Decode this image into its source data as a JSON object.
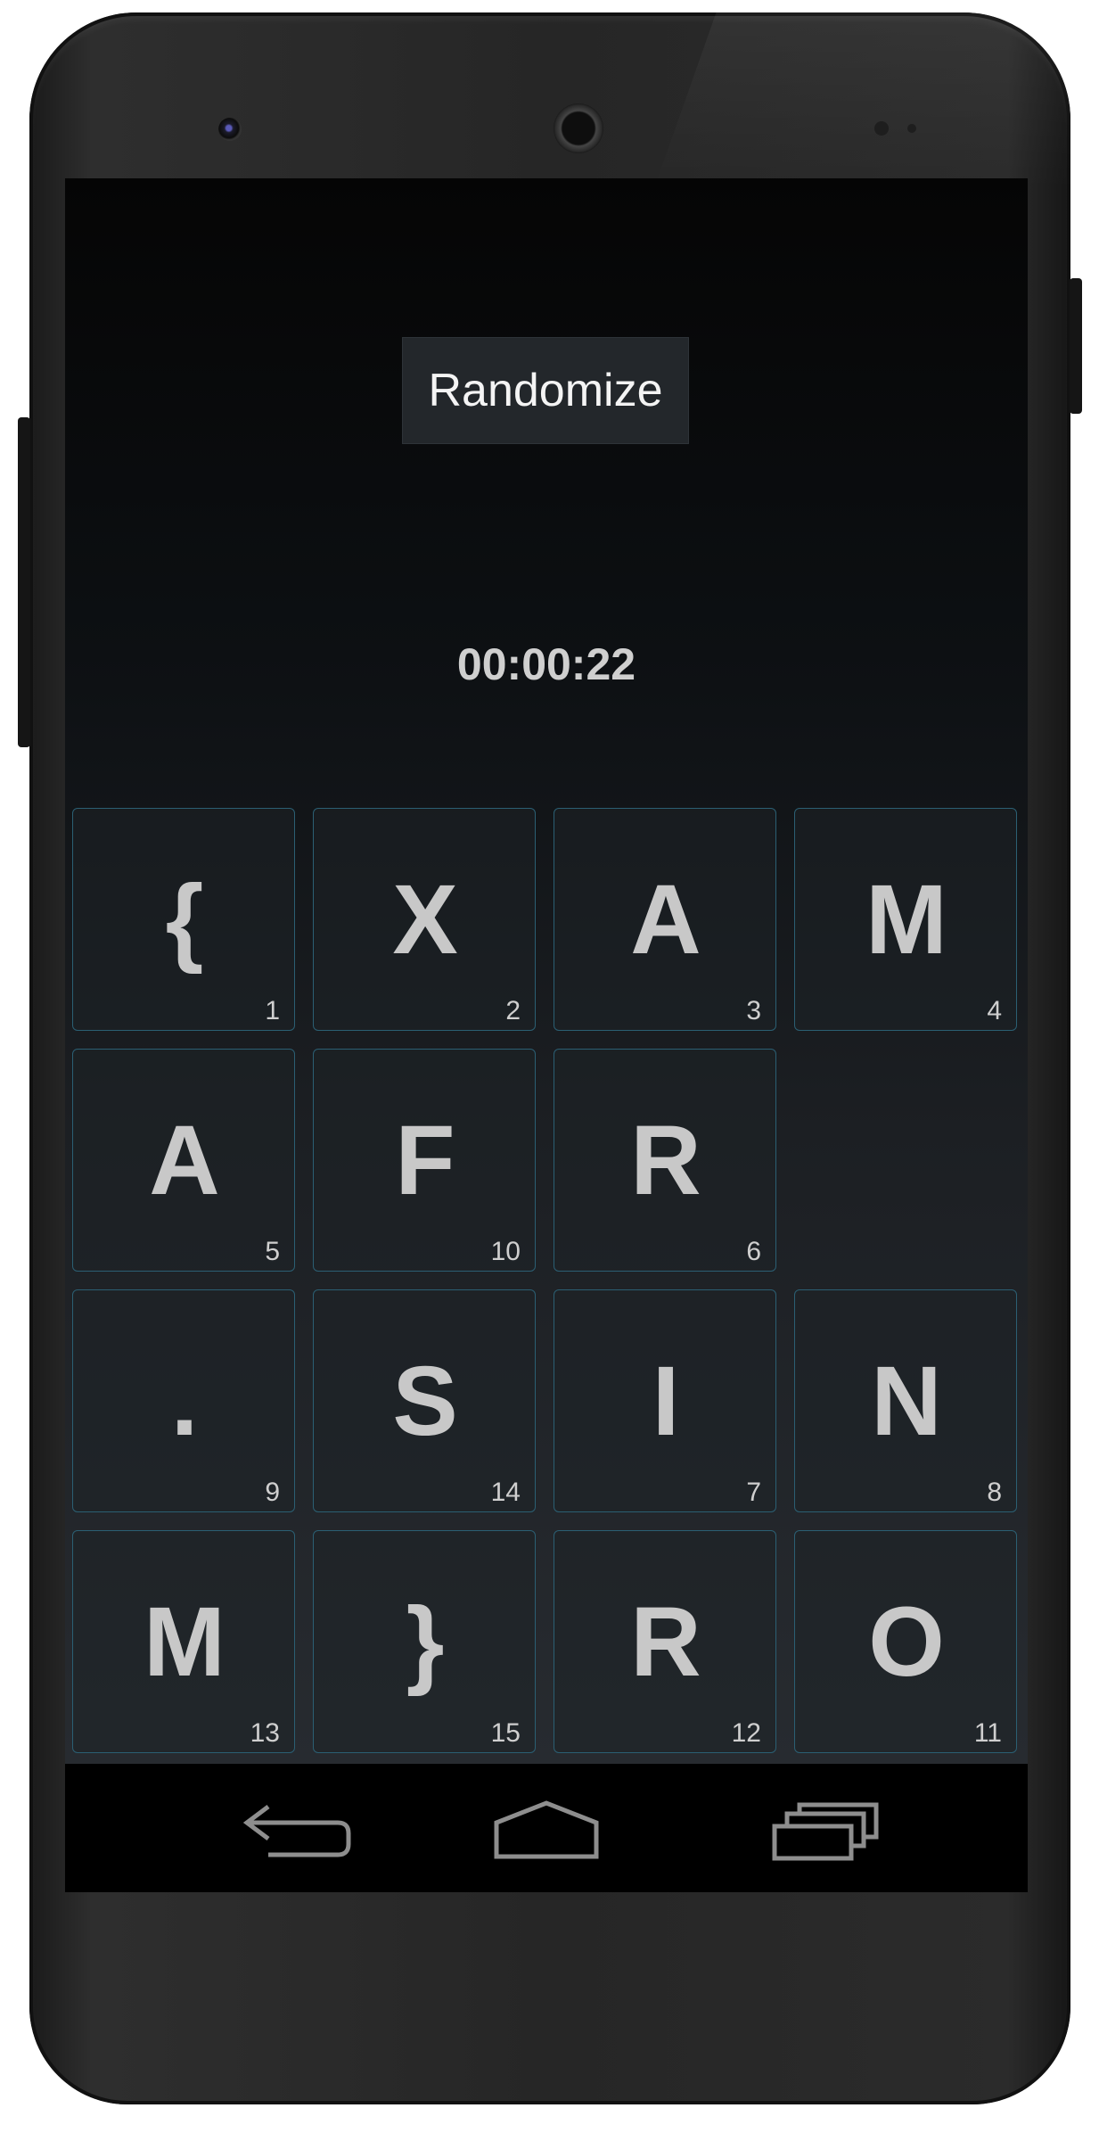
{
  "app": {
    "randomize_label": "Randomize",
    "timer": "00:00:22"
  },
  "board": {
    "tiles": [
      {
        "letter": "{",
        "number": "1"
      },
      {
        "letter": "X",
        "number": "2"
      },
      {
        "letter": "A",
        "number": "3"
      },
      {
        "letter": "M",
        "number": "4"
      },
      {
        "letter": "A",
        "number": "5"
      },
      {
        "letter": "F",
        "number": "10"
      },
      {
        "letter": "R",
        "number": "6"
      },
      null,
      {
        "letter": ".",
        "number": "9"
      },
      {
        "letter": "S",
        "number": "14"
      },
      {
        "letter": "I",
        "number": "7"
      },
      {
        "letter": "N",
        "number": "8"
      },
      {
        "letter": "M",
        "number": "13"
      },
      {
        "letter": "}",
        "number": "15"
      },
      {
        "letter": "R",
        "number": "12"
      },
      {
        "letter": "O",
        "number": "11"
      }
    ]
  },
  "navigation": {
    "buttons": [
      {
        "name": "back",
        "icon": "back-arrow-icon"
      },
      {
        "name": "home",
        "icon": "home-icon"
      },
      {
        "name": "recents",
        "icon": "recent-apps-icon"
      }
    ]
  },
  "colors": {
    "tile_border": "#2b5f73",
    "text": "#c8c8c8",
    "button_bg": "#23272b"
  }
}
